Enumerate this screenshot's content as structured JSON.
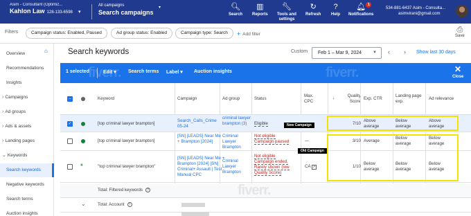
{
  "header": {
    "account_line1": "Asim - Consultant (Optimiz...",
    "account_name": "Kahlon Law",
    "account_number": "128-133-6598",
    "crumb_line1": "All campaigns",
    "crumb_title": "Search campaigns",
    "buttons": [
      {
        "label": "Search",
        "icon": "search-icon"
      },
      {
        "label": "Reports",
        "icon": "reports-icon"
      },
      {
        "label": "Tools and settings",
        "icon": "wrench-icon"
      },
      {
        "label": "Refresh",
        "icon": "refresh-icon"
      },
      {
        "label": "Help",
        "icon": "help-icon"
      },
      {
        "label": "Notifications",
        "icon": "bell-icon",
        "badge": "1"
      }
    ],
    "user_line1": "534-881-6437 Asim - Consulta...",
    "user_email": "asimvirani@gmail.com"
  },
  "filters": {
    "label": "Filters",
    "chips": [
      "Campaign status: Enabled, Paused",
      "Ad group status: Enabled",
      "Campaign type: Search"
    ],
    "add_filter": "Add filter",
    "save": "Save"
  },
  "sidenav": [
    {
      "label": "Overview",
      "active": false
    },
    {
      "label": "Recommendations",
      "active": false
    },
    {
      "label": "Insights",
      "active": false
    },
    {
      "label": "Campaigns",
      "active": false,
      "expandable": true
    },
    {
      "label": "Ad groups",
      "active": false,
      "expandable": true
    },
    {
      "label": "Ads & assets",
      "active": false,
      "expandable": true
    },
    {
      "label": "Landing pages",
      "active": false,
      "expandable": true
    },
    {
      "label": "Keywords",
      "active": false,
      "expandable": true,
      "expanded": true
    },
    {
      "label": "Search keywords",
      "active": true
    },
    {
      "label": "Negative keywords",
      "active": false
    },
    {
      "label": "Search terms",
      "active": false
    },
    {
      "label": "Auction insights",
      "active": false
    }
  ],
  "main": {
    "title": "Search keywords",
    "date_mode": "Custom",
    "date_range": "Feb 1 – Mar 9, 2024",
    "show_last": "Show last 30 days"
  },
  "actionbar": {
    "selected": "1 selected",
    "edit": "Edit",
    "search_terms": "Search terms",
    "label": "Label",
    "auction_insights": "Auction insights",
    "close": "Close",
    "watermark": "fiverr."
  },
  "table": {
    "headers": {
      "keyword": "Keyword",
      "campaign": "Campaign",
      "ad_group": "Ad group",
      "status": "Status",
      "max_cpc": "Max. CPC",
      "quality_score": "Quality Score",
      "exp_ctr": "Exp. CTR",
      "landing_page_exp": "Landing page exp.",
      "ad_relevance": "Ad relevance"
    },
    "rows": [
      {
        "keyword": "[top criminal lawyer brampton]",
        "campaign": "Search_Calls_Crime 05-24",
        "ad_group": "criminal lawyer brampton (3)",
        "status": "Eligible",
        "max_cpc": "",
        "quality_score": "7/10",
        "exp_ctr": "Above average",
        "landing_page_exp": "Below average",
        "ad_relevance": "Above average",
        "tag": "New Campaign"
      },
      {
        "keyword": "[top criminal lawyer brampton]",
        "campaign": "[SN] [LEADS] Near Me + Brampton [2024]",
        "ad_group": "Criminal Lawyer Brampton",
        "status": "Not eligible Campaign paused",
        "max_cpc": "—",
        "quality_score": "3/10",
        "exp_ctr": "Average",
        "landing_page_exp": "Below average",
        "ad_relevance": "Below average",
        "tag": "Old Campaign"
      },
      {
        "keyword": "\"top criminal lawyer brampton\"",
        "campaign": "[SN] [LEADS] Near Me + Brampton [2024] [SN] Criminal+ Assault | Test Manual CPC",
        "ad_group": "Criminal Lawyer Brampton",
        "status": "Not eligible Campaign ended, Rarely shown (low Quality Score)",
        "max_cpc": "CA",
        "quality_score": "1/10",
        "exp_ctr": "Below average",
        "landing_page_exp": "Below average",
        "ad_relevance": "Below average"
      }
    ],
    "total_filtered": "Total: Filtered keywords",
    "total_account": "Total: Account"
  },
  "colors": {
    "header_bg": "#1f3a8f",
    "action_bar": "#1a73e8",
    "highlight": "#f4e200",
    "eligible": "#188038",
    "not_eligible": "#c5221f"
  }
}
